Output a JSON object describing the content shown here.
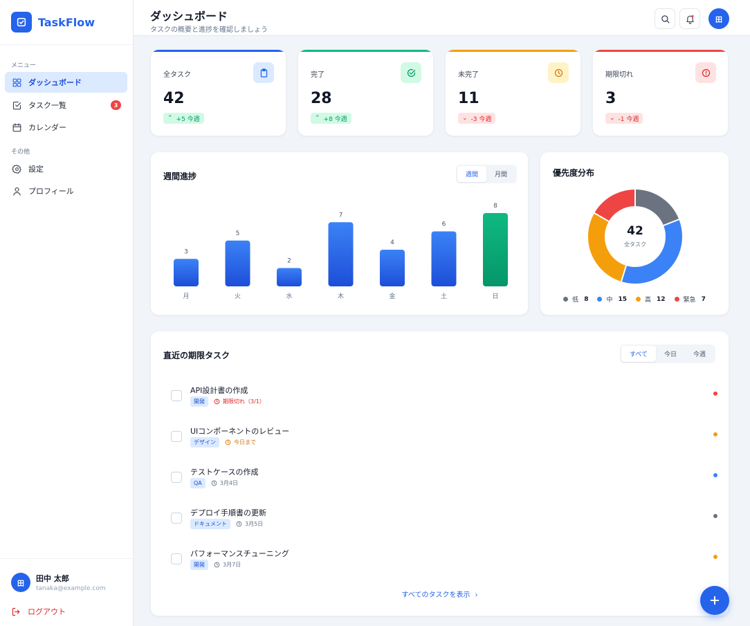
{
  "app": {
    "name": "TaskFlow"
  },
  "sidebar": {
    "section_menu": "メニュー",
    "section_other": "その他",
    "items": [
      {
        "label": "ダッシュボード",
        "icon": "grid-icon",
        "active": true
      },
      {
        "label": "タスク一覧",
        "icon": "checkbox-icon",
        "badge": "3"
      },
      {
        "label": "カレンダー",
        "icon": "calendar-icon"
      },
      {
        "label": "設定",
        "icon": "gear-icon"
      },
      {
        "label": "プロフィール",
        "icon": "user-icon"
      }
    ],
    "user": {
      "initial": "田",
      "name": "田中 太郎",
      "email": "tanaka@example.com"
    },
    "logout_label": "ログアウト"
  },
  "header": {
    "title": "ダッシュボード",
    "subtitle": "タスクの概要と進捗を確認しましょう",
    "avatar_initial": "田"
  },
  "stats": [
    {
      "label": "全タスク",
      "value": "42",
      "delta": "+5 今週",
      "trend": "up",
      "color": "#2563eb",
      "icon": "clipboard-icon"
    },
    {
      "label": "完了",
      "value": "28",
      "delta": "+8 今週",
      "trend": "up",
      "color": "#10b981",
      "icon": "check-circle-icon"
    },
    {
      "label": "未完了",
      "value": "11",
      "delta": "-3 今週",
      "trend": "down",
      "color": "#f59e0b",
      "icon": "clock-icon"
    },
    {
      "label": "期限切れ",
      "value": "3",
      "delta": "-1 今週",
      "trend": "down",
      "color": "#ef4444",
      "icon": "alert-circle-icon"
    }
  ],
  "weekly": {
    "title": "週間進捗",
    "tabs": [
      "週間",
      "月間"
    ],
    "active_tab": "週間"
  },
  "chart_data": [
    {
      "type": "bar",
      "title": "週間進捗",
      "categories": [
        "月",
        "火",
        "水",
        "木",
        "金",
        "土",
        "日"
      ],
      "values": [
        3,
        5,
        2,
        7,
        4,
        6,
        8
      ],
      "highlight_index": 6,
      "colors": {
        "default": "#2563eb",
        "highlight": "#10b981"
      },
      "ylim": [
        0,
        8
      ]
    },
    {
      "type": "pie",
      "title": "優先度分布",
      "center_value": "42",
      "center_label": "全タスク",
      "categories": [
        "低",
        "中",
        "高",
        "緊急"
      ],
      "values": [
        8,
        15,
        12,
        7
      ],
      "colors": [
        "#6b7280",
        "#3b82f6",
        "#f59e0b",
        "#ef4444"
      ]
    }
  ],
  "recent": {
    "title": "直近の期限タスク",
    "filters": [
      "すべて",
      "今日",
      "今週"
    ],
    "active_filter": "すべて",
    "tasks": [
      {
        "title": "API設計書の作成",
        "tag": "開発",
        "due": "期限切れ（3/1）",
        "due_color": "#dc2626",
        "priority_color": "#ef4444"
      },
      {
        "title": "UIコンポーネントのレビュー",
        "tag": "デザイン",
        "due": "今日まで",
        "due_color": "#d97706",
        "priority_color": "#f59e0b"
      },
      {
        "title": "テストケースの作成",
        "tag": "QA",
        "due": "3月4日",
        "due_color": "#64748b",
        "priority_color": "#3b82f6"
      },
      {
        "title": "デプロイ手順書の更新",
        "tag": "ドキュメント",
        "due": "3月5日",
        "due_color": "#64748b",
        "priority_color": "#6b7280"
      },
      {
        "title": "パフォーマンスチューニング",
        "tag": "開発",
        "due": "3月7日",
        "due_color": "#64748b",
        "priority_color": "#f59e0b"
      }
    ],
    "view_all": "すべてのタスクを表示"
  }
}
